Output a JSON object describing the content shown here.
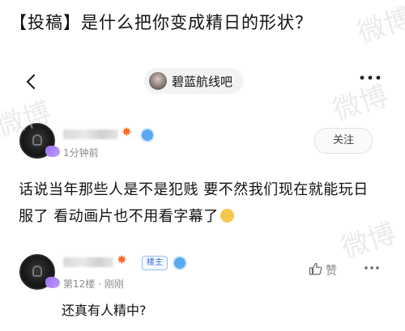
{
  "header": {
    "title": "【投稿】是什么把你变成精日的形状？"
  },
  "topbar": {
    "back_icon": "chevron-left-icon",
    "forum_name": "碧蓝航线吧",
    "more_icon": "more-horizontal-icon"
  },
  "post": {
    "time": "1分钟前",
    "follow_label": "关注",
    "body_line1": "话说当年那些人是不是犯贱 要不然我们现在就能玩日",
    "body_line2": "服了 看动画片也不用看字幕了"
  },
  "reply": {
    "badge": "楼主",
    "floor": "第12楼",
    "dot": "·",
    "time": "刚刚",
    "like_label": "赞",
    "text": "还真有人精中?"
  },
  "watermark_text": "微博"
}
